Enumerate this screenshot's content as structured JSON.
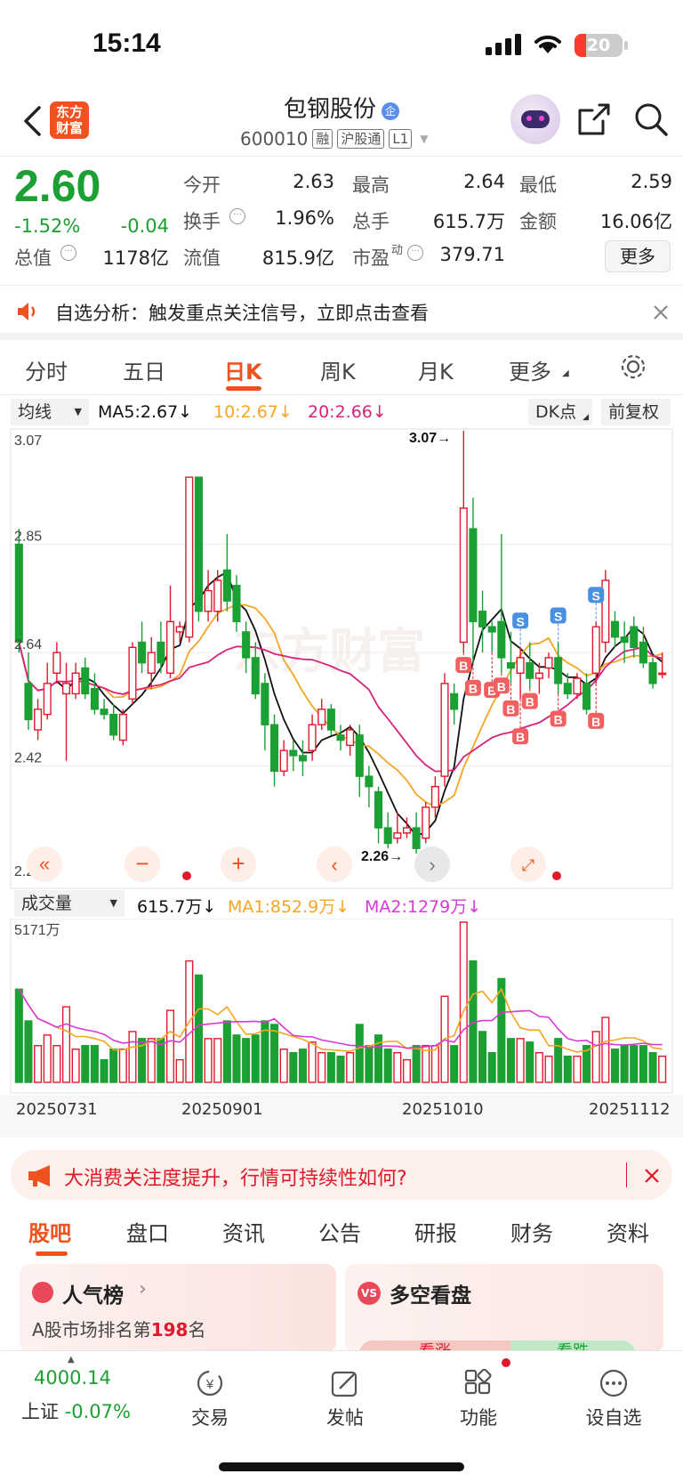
{
  "status_bar": {
    "time": "15:14",
    "battery": "20"
  },
  "header": {
    "logo_text": "东方财富",
    "stock_name": "包钢股份",
    "stock_code": "600010",
    "tags": [
      "融",
      "沪股通",
      "L1"
    ]
  },
  "quote": {
    "price": "2.60",
    "change_pct": "-1.52%",
    "change": "-0.04",
    "open_label": "今开",
    "open": "2.63",
    "high_label": "最高",
    "high": "2.64",
    "low_label": "最低",
    "low": "2.59",
    "turnover_label": "换手",
    "turnover": "1.96%",
    "volume_label": "总手",
    "volume": "615.7万",
    "amount_label": "金额",
    "amount": "16.06亿",
    "mktcap_label": "总值",
    "mktcap": "1178亿",
    "float_label": "流值",
    "float": "815.9亿",
    "pe_label": "市盈",
    "pe_sup": "动",
    "pe": "379.71",
    "more_button": "更多"
  },
  "notice": {
    "text": "自选分析：触发重点关注信号，立即点击查看"
  },
  "chart_tabs": [
    "分时",
    "五日",
    "日K",
    "周K",
    "月K",
    "更多"
  ],
  "chart_tabs_active": "日K",
  "ma_bar": {
    "selector": "均线",
    "ma5": "MA5:2.67↓",
    "ma10": "10:2.67↓",
    "ma20": "20:2.66↓",
    "dk": "DK点",
    "fq": "前复权"
  },
  "price_axis": [
    "3.07",
    "2.85",
    "2.64",
    "2.42",
    "2.20"
  ],
  "price_annotations": {
    "high": "3.07→",
    "low": "2.26→"
  },
  "signals": {
    "buy": "B",
    "sell": "S"
  },
  "vol_bar": {
    "selector": "成交量",
    "vol": "615.7万↓",
    "ma1": "MA1:852.9万↓",
    "ma2": "MA2:1279万↓"
  },
  "vol_axis_max": "5171万",
  "dates": [
    "20250731",
    "20250901",
    "20251010",
    "20251112"
  ],
  "colors": {
    "up": "#e0182c",
    "down": "#1aa033",
    "ma5": "#111111",
    "ma10": "#f5a623",
    "ma20": "#d6247a"
  },
  "banner": {
    "text": "大消费关注度提升，行情可持续性如何?"
  },
  "bottom_tabs": [
    "股吧",
    "盘口",
    "资讯",
    "公告",
    "研报",
    "财务",
    "资料"
  ],
  "cards": {
    "left_title": "人气榜",
    "left_sub_prefix": "A股市场排名第",
    "left_rank": "198",
    "left_sub_suffix": "名",
    "right_title": "多空看盘",
    "right_up": "看涨",
    "right_down": "看跌"
  },
  "bottom_nav": {
    "index_value": "4000.14",
    "index_name": "上证",
    "index_change": "-0.07%",
    "items": [
      "交易",
      "发帖",
      "功能",
      "设自选"
    ]
  },
  "chart_data": {
    "type": "candlestick",
    "title": "",
    "ylim": [
      2.2,
      3.07
    ],
    "x_labels": [
      "20250731",
      "20250901",
      "20251010",
      "20251112"
    ],
    "series": [
      {
        "name": "日K",
        "candles": [
          [
            2.85,
            2.66,
            2.88,
            2.64
          ],
          [
            2.58,
            2.51,
            2.64,
            2.49
          ],
          [
            2.49,
            2.53,
            2.55,
            2.47
          ],
          [
            2.52,
            2.58,
            2.62,
            2.51
          ],
          [
            2.6,
            2.64,
            2.66,
            2.58
          ],
          [
            2.56,
            2.58,
            2.62,
            2.43
          ],
          [
            2.56,
            2.6,
            2.62,
            2.55
          ],
          [
            2.61,
            2.56,
            2.63,
            2.55
          ],
          [
            2.57,
            2.53,
            2.6,
            2.52
          ],
          [
            2.53,
            2.52,
            2.55,
            2.51
          ],
          [
            2.52,
            2.48,
            2.54,
            2.47
          ],
          [
            2.47,
            2.52,
            2.53,
            2.46
          ],
          [
            2.55,
            2.65,
            2.66,
            2.54
          ],
          [
            2.66,
            2.62,
            2.7,
            2.6
          ],
          [
            2.6,
            2.64,
            2.67,
            2.57
          ],
          [
            2.66,
            2.62,
            2.7,
            2.6
          ],
          [
            2.6,
            2.7,
            2.77,
            2.59
          ],
          [
            2.68,
            2.69,
            2.7,
            2.66
          ],
          [
            2.67,
            2.98,
            2.98,
            2.66
          ],
          [
            2.98,
            2.72,
            2.98,
            2.7
          ],
          [
            2.72,
            2.76,
            2.8,
            2.7
          ],
          [
            2.72,
            2.78,
            2.8,
            2.7
          ],
          [
            2.8,
            2.74,
            2.87,
            2.72
          ],
          [
            2.77,
            2.7,
            2.79,
            2.68
          ],
          [
            2.68,
            2.63,
            2.7,
            2.6
          ],
          [
            2.63,
            2.56,
            2.66,
            2.55
          ],
          [
            2.58,
            2.5,
            2.6,
            2.45
          ],
          [
            2.5,
            2.41,
            2.52,
            2.38
          ],
          [
            2.41,
            2.45,
            2.47,
            2.4
          ],
          [
            2.45,
            2.44,
            2.47,
            2.41
          ],
          [
            2.44,
            2.43,
            2.47,
            2.4
          ],
          [
            2.45,
            2.5,
            2.52,
            2.43
          ],
          [
            2.5,
            2.53,
            2.55,
            2.49
          ],
          [
            2.53,
            2.49,
            2.54,
            2.48
          ],
          [
            2.48,
            2.47,
            2.5,
            2.45
          ],
          [
            2.46,
            2.49,
            2.5,
            2.44
          ],
          [
            2.48,
            2.4,
            2.5,
            2.36
          ],
          [
            2.4,
            2.38,
            2.42,
            2.34
          ],
          [
            2.37,
            2.3,
            2.38,
            2.27
          ],
          [
            2.3,
            2.27,
            2.33,
            2.26
          ],
          [
            2.28,
            2.29,
            2.33,
            2.27
          ],
          [
            2.29,
            2.3,
            2.32,
            2.28
          ],
          [
            2.3,
            2.26,
            2.33,
            2.25
          ],
          [
            2.28,
            2.34,
            2.35,
            2.27
          ],
          [
            2.34,
            2.38,
            2.4,
            2.32
          ],
          [
            2.4,
            2.58,
            2.6,
            2.38
          ],
          [
            2.56,
            2.53,
            2.58,
            2.5
          ],
          [
            2.66,
            2.92,
            3.07,
            2.64
          ],
          [
            2.88,
            2.7,
            2.94,
            2.62
          ],
          [
            2.72,
            2.69,
            2.76,
            2.64
          ],
          [
            2.69,
            2.68,
            2.7,
            2.64
          ],
          [
            2.7,
            2.63,
            2.87,
            2.6
          ],
          [
            2.62,
            2.61,
            2.68,
            2.58
          ],
          [
            2.6,
            2.63,
            2.65,
            2.55
          ],
          [
            2.62,
            2.59,
            2.66,
            2.57
          ],
          [
            2.59,
            2.6,
            2.62,
            2.56
          ],
          [
            2.61,
            2.63,
            2.64,
            2.59
          ],
          [
            2.63,
            2.58,
            2.66,
            2.56
          ],
          [
            2.58,
            2.56,
            2.6,
            2.55
          ],
          [
            2.56,
            2.59,
            2.6,
            2.55
          ],
          [
            2.58,
            2.53,
            2.6,
            2.52
          ],
          [
            2.6,
            2.69,
            2.7,
            2.58
          ],
          [
            2.66,
            2.78,
            2.8,
            2.64
          ],
          [
            2.7,
            2.67,
            2.72,
            2.65
          ],
          [
            2.67,
            2.66,
            2.7,
            2.62
          ],
          [
            2.69,
            2.65,
            2.71,
            2.63
          ],
          [
            2.66,
            2.62,
            2.69,
            2.61
          ],
          [
            2.62,
            2.58,
            2.63,
            2.57
          ],
          [
            2.6,
            2.6,
            2.64,
            2.59
          ]
        ]
      }
    ]
  }
}
